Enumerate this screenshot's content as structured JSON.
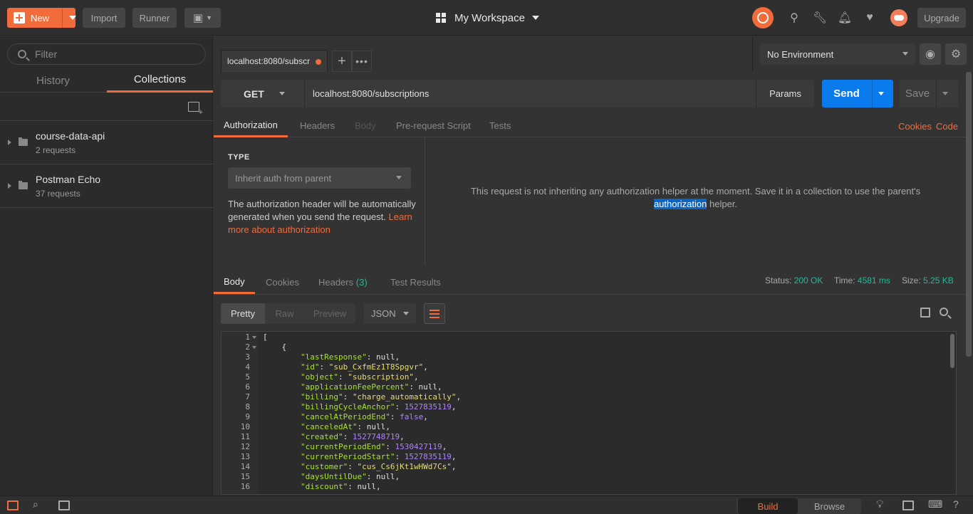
{
  "header": {
    "new_label": "New",
    "import_label": "Import",
    "runner_label": "Runner",
    "workspace": "My Workspace",
    "upgrade_label": "Upgrade"
  },
  "sidebar": {
    "filter_placeholder": "Filter",
    "tabs": [
      {
        "label": "History"
      },
      {
        "label": "Collections"
      }
    ],
    "collections": [
      {
        "name": "course-data-api",
        "count": "2 requests"
      },
      {
        "name": "Postman Echo",
        "count": "37 requests"
      }
    ]
  },
  "request_tab": {
    "title": "localhost:8080/subscr"
  },
  "environment": {
    "selected": "No Environment"
  },
  "request": {
    "method": "GET",
    "url": "localhost:8080/subscriptions",
    "params_label": "Params",
    "send_label": "Send",
    "save_label": "Save"
  },
  "request_tabs": [
    {
      "label": "Authorization"
    },
    {
      "label": "Headers"
    },
    {
      "label": "Body"
    },
    {
      "label": "Pre-request Script"
    },
    {
      "label": "Tests"
    }
  ],
  "request_links": {
    "cookies": "Cookies",
    "code": "Code"
  },
  "auth": {
    "type_label": "TYPE",
    "type_value": "Inherit auth from parent",
    "desc": "The authorization header will be automatically generated when you send the request.",
    "learn_more": "Learn more about authorization",
    "message_1": "This request is not inheriting any authorization helper at the moment. Save it in a collection to use the parent's",
    "message_highlight": "authorization",
    "message_2": "helper."
  },
  "response": {
    "tabs": [
      {
        "label": "Body"
      },
      {
        "label": "Cookies"
      },
      {
        "label": "Headers",
        "count": "(3)"
      },
      {
        "label": "Test Results"
      }
    ],
    "status_label": "Status:",
    "status_value": "200 OK",
    "time_label": "Time:",
    "time_value": "4581 ms",
    "size_label": "Size:",
    "size_value": "5.25 KB",
    "view_modes": [
      "Pretty",
      "Raw",
      "Preview"
    ],
    "format": "JSON",
    "lines": [
      {
        "n": "1",
        "fold": true,
        "parts": [
          {
            "t": "[",
            "c": ""
          }
        ]
      },
      {
        "n": "2",
        "fold": true,
        "parts": [
          {
            "t": "    {",
            "c": ""
          }
        ]
      },
      {
        "n": "3",
        "parts": [
          {
            "t": "        ",
            "c": ""
          },
          {
            "t": "\"lastResponse\"",
            "c": "k"
          },
          {
            "t": ": null,",
            "c": ""
          }
        ]
      },
      {
        "n": "4",
        "parts": [
          {
            "t": "        ",
            "c": ""
          },
          {
            "t": "\"id\"",
            "c": "k"
          },
          {
            "t": ": ",
            "c": ""
          },
          {
            "t": "\"sub_CxfmEz1T8Spgvr\"",
            "c": "s"
          },
          {
            "t": ",",
            "c": ""
          }
        ]
      },
      {
        "n": "5",
        "parts": [
          {
            "t": "        ",
            "c": ""
          },
          {
            "t": "\"object\"",
            "c": "k"
          },
          {
            "t": ": ",
            "c": ""
          },
          {
            "t": "\"subscription\"",
            "c": "s"
          },
          {
            "t": ",",
            "c": ""
          }
        ]
      },
      {
        "n": "6",
        "parts": [
          {
            "t": "        ",
            "c": ""
          },
          {
            "t": "\"applicationFeePercent\"",
            "c": "k"
          },
          {
            "t": ": null,",
            "c": ""
          }
        ]
      },
      {
        "n": "7",
        "parts": [
          {
            "t": "        ",
            "c": ""
          },
          {
            "t": "\"billing\"",
            "c": "k"
          },
          {
            "t": ": ",
            "c": ""
          },
          {
            "t": "\"charge_automatically\"",
            "c": "s"
          },
          {
            "t": ",",
            "c": ""
          }
        ]
      },
      {
        "n": "8",
        "parts": [
          {
            "t": "        ",
            "c": ""
          },
          {
            "t": "\"billingCycleAnchor\"",
            "c": "k"
          },
          {
            "t": ": ",
            "c": ""
          },
          {
            "t": "1527835119",
            "c": "n"
          },
          {
            "t": ",",
            "c": ""
          }
        ]
      },
      {
        "n": "9",
        "parts": [
          {
            "t": "        ",
            "c": ""
          },
          {
            "t": "\"cancelAtPeriodEnd\"",
            "c": "k"
          },
          {
            "t": ": ",
            "c": ""
          },
          {
            "t": "false",
            "c": "n"
          },
          {
            "t": ",",
            "c": ""
          }
        ]
      },
      {
        "n": "10",
        "parts": [
          {
            "t": "        ",
            "c": ""
          },
          {
            "t": "\"canceledAt\"",
            "c": "k"
          },
          {
            "t": ": null,",
            "c": ""
          }
        ]
      },
      {
        "n": "11",
        "parts": [
          {
            "t": "        ",
            "c": ""
          },
          {
            "t": "\"created\"",
            "c": "k"
          },
          {
            "t": ": ",
            "c": ""
          },
          {
            "t": "1527748719",
            "c": "n"
          },
          {
            "t": ",",
            "c": ""
          }
        ]
      },
      {
        "n": "12",
        "parts": [
          {
            "t": "        ",
            "c": ""
          },
          {
            "t": "\"currentPeriodEnd\"",
            "c": "k"
          },
          {
            "t": ": ",
            "c": ""
          },
          {
            "t": "1530427119",
            "c": "n"
          },
          {
            "t": ",",
            "c": ""
          }
        ]
      },
      {
        "n": "13",
        "parts": [
          {
            "t": "        ",
            "c": ""
          },
          {
            "t": "\"currentPeriodStart\"",
            "c": "k"
          },
          {
            "t": ": ",
            "c": ""
          },
          {
            "t": "1527835119",
            "c": "n"
          },
          {
            "t": ",",
            "c": ""
          }
        ]
      },
      {
        "n": "14",
        "parts": [
          {
            "t": "        ",
            "c": ""
          },
          {
            "t": "\"customer\"",
            "c": "k"
          },
          {
            "t": ": ",
            "c": ""
          },
          {
            "t": "\"cus_Cs6jKt1wHWd7Cs\"",
            "c": "s"
          },
          {
            "t": ",",
            "c": ""
          }
        ]
      },
      {
        "n": "15",
        "parts": [
          {
            "t": "        ",
            "c": ""
          },
          {
            "t": "\"daysUntilDue\"",
            "c": "k"
          },
          {
            "t": ": null,",
            "c": ""
          }
        ]
      },
      {
        "n": "16",
        "parts": [
          {
            "t": "        ",
            "c": ""
          },
          {
            "t": "\"discount\"",
            "c": "k"
          },
          {
            "t": ": null,",
            "c": ""
          }
        ]
      }
    ]
  },
  "bottombar": {
    "build_label": "Build",
    "browse_label": "Browse"
  }
}
